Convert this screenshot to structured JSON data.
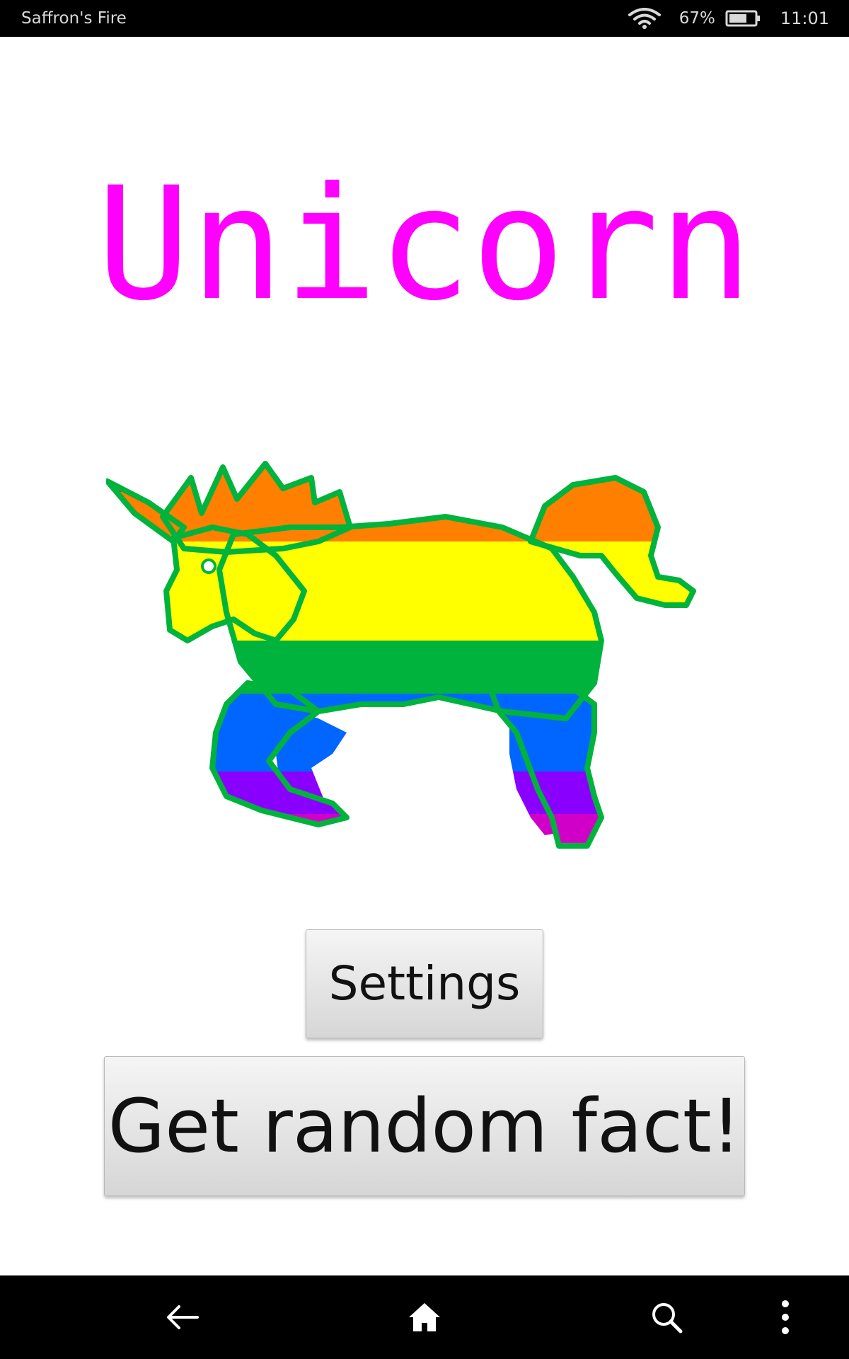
{
  "status_bar": {
    "device_name": "Saffron's Fire",
    "battery_percent": "67%",
    "battery_level": 0.67,
    "time": "11:01",
    "icons": [
      "wifi-icon",
      "battery-icon"
    ]
  },
  "app": {
    "title": "Unicorn",
    "title_color": "#ff00ff",
    "image": "rainbow-unicorn-pixel-art"
  },
  "buttons": {
    "settings_label": "Settings",
    "fact_label": "Get random fact!"
  },
  "nav_bar": {
    "icons": [
      "back-arrow-icon",
      "home-icon",
      "search-icon",
      "overflow-menu-icon"
    ]
  }
}
